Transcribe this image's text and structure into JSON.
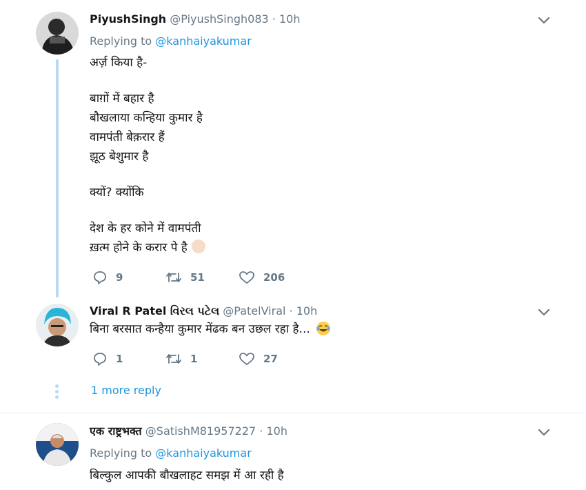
{
  "tweets": [
    {
      "name": "PiyushSingh",
      "handle": "@PiyushSingh083",
      "separator": "·",
      "time": "10h",
      "replying_prefix": "Replying to",
      "replying_to": "@kanhaiyakumar",
      "lines": [
        "अर्ज़ किया है-",
        "बाग़ों में बहार है",
        "बौखलाया कन्हिया कुमार है",
        "वामपंती बेक़रार हैं",
        "झूठ बेशुमार है",
        "क्यों? क्योंकि",
        "देश के हर कोने में वामपंती",
        "ख़त्म होने के करार पे है"
      ],
      "replies": "9",
      "retweets": "51",
      "likes": "206"
    },
    {
      "name": "Viral R Patel વિરલ પટેલ",
      "handle": "@PatelViral",
      "separator": "·",
      "time": "10h",
      "lines": [
        "बिना बरसात कन्हैया कुमार मेंढक बन उछल रहा है..."
      ],
      "replies": "1",
      "retweets": "1",
      "likes": "27"
    },
    {
      "name": "एक राष्ट्रभक्त",
      "handle": "@SatishM81957227",
      "separator": "·",
      "time": "10h",
      "replying_prefix": "Replying to",
      "replying_to": "@kanhaiyakumar",
      "lines": [
        "बिल्कुल आपकी बौखलाहट समझ में आ रही है"
      ]
    }
  ],
  "more_replies": "1 more reply",
  "icons": [
    "reply-icon",
    "retweet-icon",
    "like-icon",
    "chevron-down-icon",
    "fist-emoji",
    "laughing-emoji"
  ],
  "colors": {
    "link": "#1b95e0",
    "muted": "#657786",
    "thread": "#b7d9f3",
    "text": "#14171a"
  }
}
